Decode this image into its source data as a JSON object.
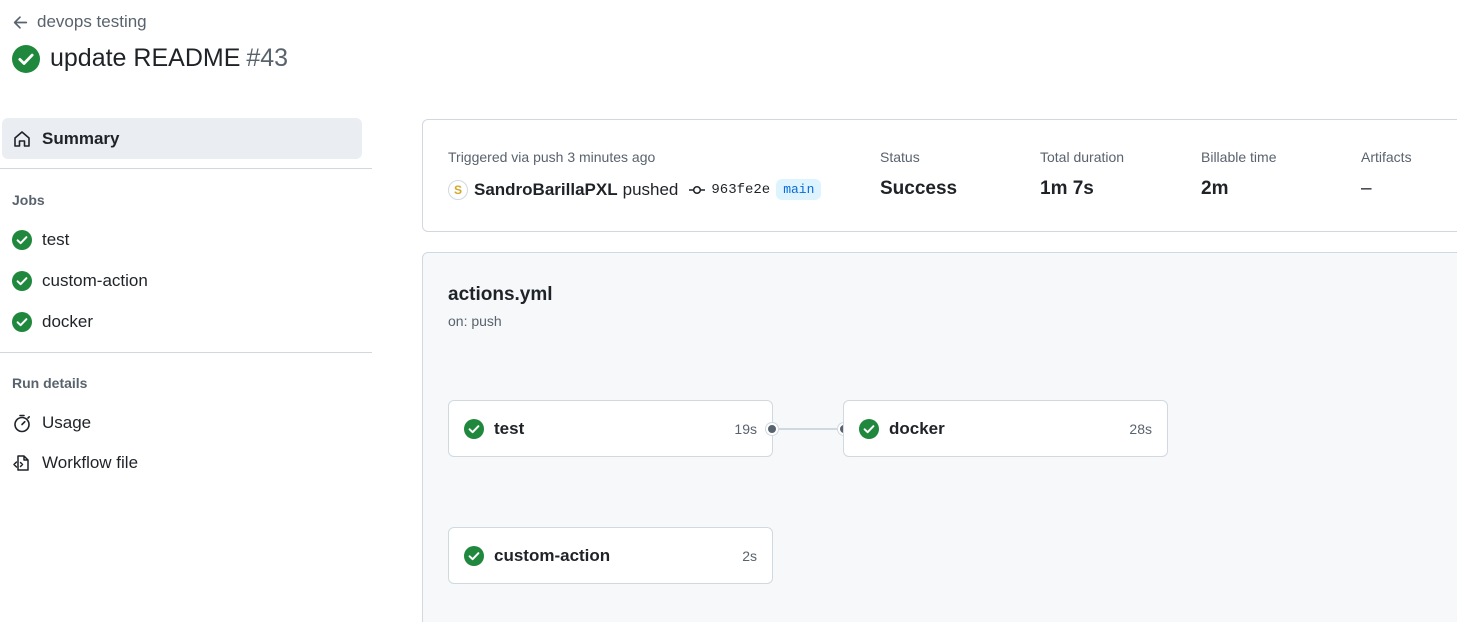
{
  "header": {
    "back_label": "devops testing",
    "run_title": "update README",
    "run_number": "#43"
  },
  "sidebar": {
    "summary_label": "Summary",
    "jobs_heading": "Jobs",
    "jobs": [
      {
        "label": "test",
        "status": "success"
      },
      {
        "label": "custom-action",
        "status": "success"
      },
      {
        "label": "docker",
        "status": "success"
      }
    ],
    "run_details_heading": "Run details",
    "usage_label": "Usage",
    "workflow_file_label": "Workflow file"
  },
  "summary": {
    "trigger_text": "Triggered via push 3 minutes ago",
    "actor_initial": "S",
    "actor": "SandroBarillaPXL",
    "action": "pushed",
    "commit_sha": "963fe2e",
    "branch": "main",
    "status_label": "Status",
    "status_value": "Success",
    "duration_label": "Total duration",
    "duration_value": "1m 7s",
    "billable_label": "Billable time",
    "billable_value": "2m",
    "artifacts_label": "Artifacts",
    "artifacts_value": "–"
  },
  "workflow": {
    "file_name": "actions.yml",
    "trigger": "on: push",
    "jobs": [
      {
        "name": "test",
        "duration": "19s",
        "status": "success"
      },
      {
        "name": "docker",
        "duration": "28s",
        "status": "success"
      },
      {
        "name": "custom-action",
        "duration": "2s",
        "status": "success"
      }
    ]
  },
  "colors": {
    "success": "#1f883d",
    "accent": "#0969da",
    "muted": "#59636e"
  }
}
